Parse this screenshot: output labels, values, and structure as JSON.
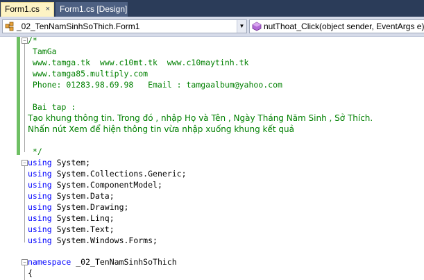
{
  "tabs": [
    {
      "label": "Form1.cs",
      "close": "×"
    },
    {
      "label": "Form1.cs [Design]"
    }
  ],
  "nav": {
    "class_combo": "_02_TenNamSinhSoThich.Form1",
    "member_combo": "nutThoat_Click(object sender, EventArgs e)"
  },
  "code": {
    "comment_open": "/*",
    "c1": " TamGa",
    "c2": " www.tamga.tk  www.c10mt.tk  www.c10maytinh.tk",
    "c3": " www.tamga85.multiply.com",
    "c4": " Phone: 01283.98.69.98   Email : tamgaalbum@yahoo.com",
    "c5": " Bai tap :",
    "c6": "Tạo khung thông tin. Trong đó , nhập Họ và Tên , Ngày Tháng Năm Sinh , Sở Thích.",
    "c7": "Nhấn nút Xem để hiện thông tin vừa nhập xuống khung kết quả",
    "comment_close": " */",
    "using_kw": "using",
    "usings": [
      "System;",
      "System.Collections.Generic;",
      "System.ComponentModel;",
      "System.Data;",
      "System.Drawing;",
      "System.Linq;",
      "System.Text;",
      "System.Windows.Forms;"
    ],
    "namespace_kw": "namespace",
    "namespace_name": "_02_TenNamSinhSoThich",
    "brace_open": "{"
  }
}
